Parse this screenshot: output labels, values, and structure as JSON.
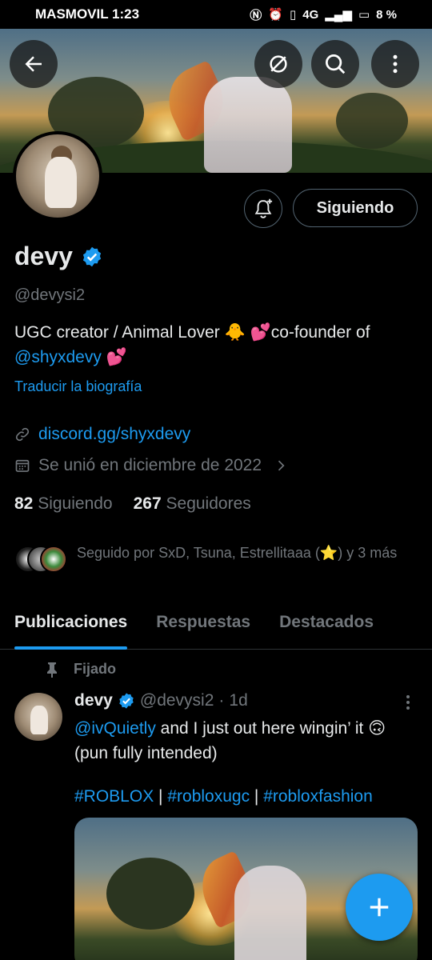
{
  "status_bar": {
    "carrier_time": "MASMOVIL 1:23",
    "network": "4G",
    "battery": "8 %"
  },
  "profile": {
    "name": "devy",
    "handle": "@devysi2",
    "bio_prefix": "UGC creator / Animal Lover 🐥  💕co-founder of ",
    "bio_mention": "@shyxdevy",
    "bio_suffix": " 💕",
    "translate": "Traducir la biografía",
    "website": "discord.gg/shyxdevy",
    "joined": "Se unió en diciembre de 2022",
    "following_count": "82",
    "following_label": "Siguiendo",
    "followers_count": "267",
    "followers_label": "Seguidores",
    "followed_by": "Seguido por SxD, Tsuna, Estrellitaaa (⭐) y 3 más",
    "follow_button": "Siguiendo"
  },
  "tabs": [
    {
      "label": "Publicaciones",
      "active": true
    },
    {
      "label": "Respuestas",
      "active": false
    },
    {
      "label": "Destacados",
      "active": false
    }
  ],
  "pinned_label": "Fijado",
  "tweet": {
    "name": "devy",
    "handle": "@devysi2",
    "sep": "·",
    "time": "1d",
    "mention": "@ivQuietly",
    "text": " and I just out here wingin’ it 🙃 (pun fully intended)",
    "tag1": "#ROBLOX",
    "tag2": "#robloxugc",
    "tag3": "#robloxfashion",
    "tag_sep": " | "
  },
  "colors": {
    "accent": "#1d9bf0",
    "secondary_text": "#71767b",
    "primary_text": "#e7e9ea",
    "background": "#000000"
  },
  "icons": [
    "back-arrow-icon",
    "no-sync-icon",
    "search-icon",
    "more-vertical-icon",
    "bell-plus-icon",
    "verified-badge-icon",
    "link-icon",
    "calendar-icon",
    "chevron-right-icon",
    "pin-icon",
    "compose-plus-icon"
  ]
}
